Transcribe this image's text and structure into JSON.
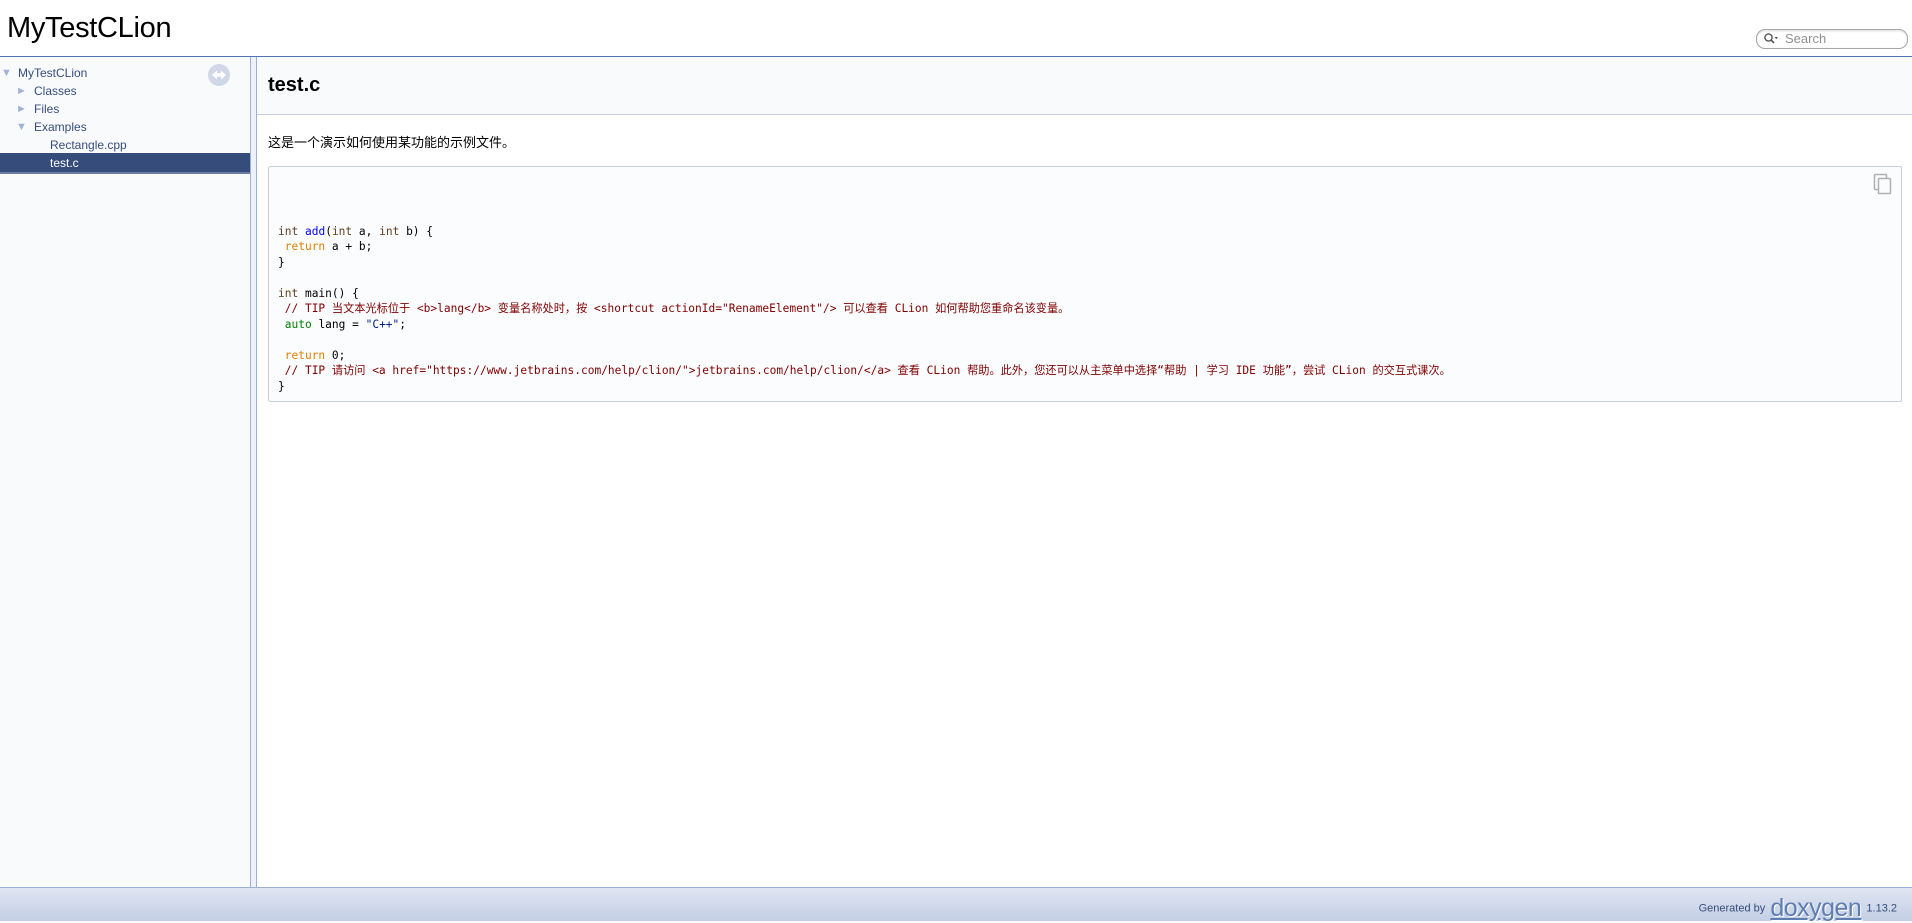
{
  "header": {
    "project_name": "MyTestCLion",
    "search_placeholder": "Search"
  },
  "sidebar": {
    "items": [
      {
        "label": "MyTestCLion",
        "level": 0,
        "expanded": true,
        "arrow": "▼"
      },
      {
        "label": "Classes",
        "level": 1,
        "expanded": false,
        "arrow": "►"
      },
      {
        "label": "Files",
        "level": 1,
        "expanded": false,
        "arrow": "►"
      },
      {
        "label": "Examples",
        "level": 1,
        "expanded": true,
        "arrow": "▼"
      },
      {
        "label": "Rectangle.cpp",
        "level": 2,
        "expanded": false,
        "arrow": ""
      },
      {
        "label": "test.c",
        "level": 2,
        "selected": true,
        "arrow": ""
      }
    ],
    "sync_icon": "sync-arrows-icon"
  },
  "content": {
    "title": "test.c",
    "intro": "这是一个演示如何使用某功能的示例文件。",
    "copy_icon": "copy-icon",
    "code_lines": [
      "",
      "",
      "",
      "int add(int a, int b) {",
      " return a + b;",
      "}",
      "",
      "int main() {",
      " // TIP 当文本光标位于 <b>lang</b> 变量名称处时，按 <shortcut actionId=\"RenameElement\"/> 可以查看 CLion 如何帮助您重命名该变量。",
      " auto lang = \"C++\";",
      "",
      " return 0;",
      " // TIP 请访问 <a href=\"https://www.jetbrains.com/help/clion/\">jetbrains.com/help/clion/</a> 查看 CLion 帮助。此外，您还可以从主菜单中选择“帮助 | 学习 IDE 功能”，尝试 CLion 的交互式课次。",
      "}"
    ]
  },
  "footer": {
    "generated_by": "Generated by",
    "logo_text": "doxygen",
    "version": "1.13.2"
  },
  "colors": {
    "accent": "#364D7C",
    "border": "#9CAFD4",
    "comment": "#800000",
    "keyword": "#008000",
    "type": "#604020",
    "string": "#002080"
  }
}
